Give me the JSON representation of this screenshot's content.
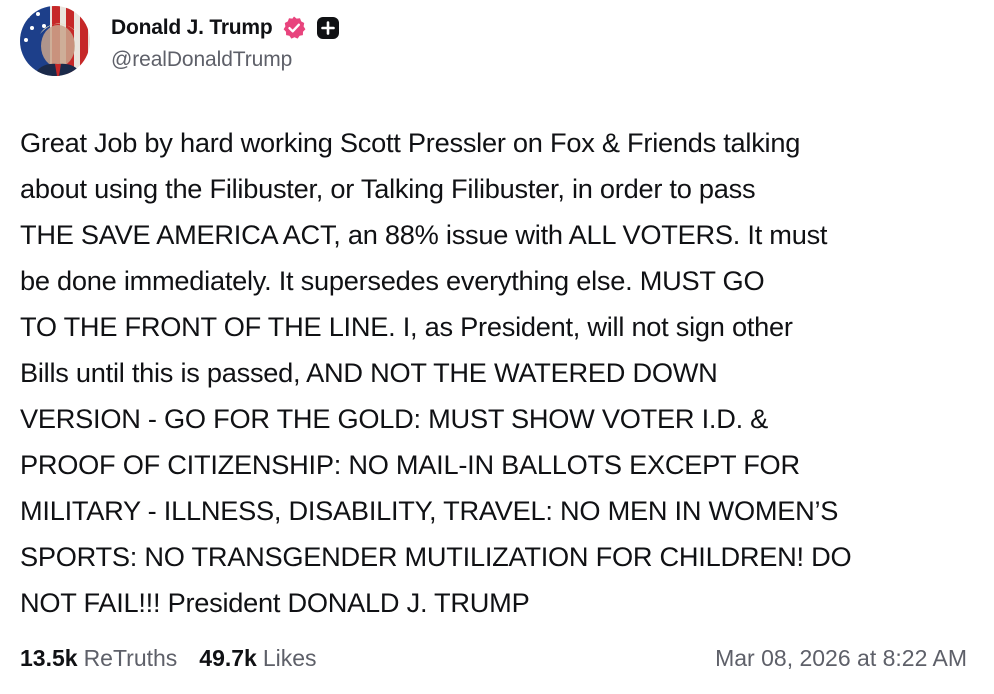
{
  "author": {
    "display_name": "Donald J. Trump",
    "handle": "@realDonaldTrump",
    "verified_icon": "verified-badge-icon",
    "verified_color": "#e8447d",
    "plus_icon": "plus-square-icon"
  },
  "post": {
    "text": "Great Job by hard working Scott Pressler on Fox & Friends talking\nabout using the Filibuster, or Talking Filibuster, in order to pass\nTHE SAVE AMERICA ACT, an 88% issue with ALL VOTERS. It must\nbe done immediately. It supersedes everything else. MUST GO\nTO THE FRONT OF THE LINE. I, as President, will not sign other\nBills until this is passed, AND NOT THE WATERED DOWN\nVERSION - GO FOR THE GOLD: MUST SHOW VOTER I.D. &\nPROOF OF CITIZENSHIP: NO MAIL-IN BALLOTS EXCEPT FOR\nMILITARY - ILLNESS, DISABILITY, TRAVEL: NO MEN IN WOMEN’S\nSPORTS: NO TRANSGENDER MUTILIZATION FOR CHILDREN! DO\nNOT FAIL!!! President DONALD J. TRUMP"
  },
  "stats": {
    "retruths_count": "13.5k",
    "retruths_label": "ReTruths",
    "likes_count": "49.7k",
    "likes_label": "Likes"
  },
  "timestamp": "Mar 08, 2026 at 8:22 AM"
}
